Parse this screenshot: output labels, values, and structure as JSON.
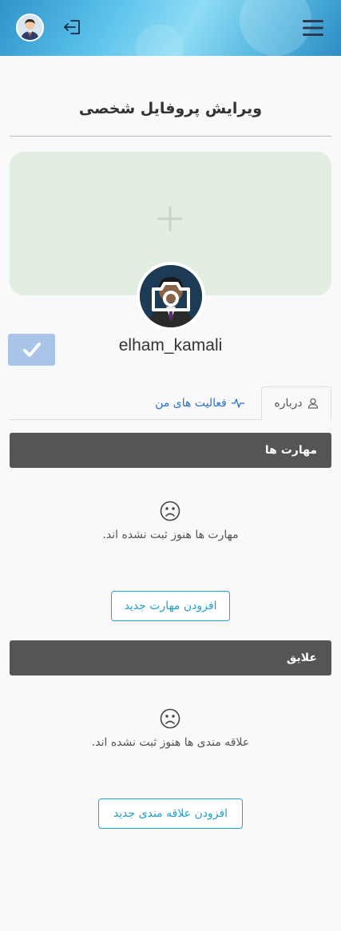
{
  "header": {
    "avatar_icon": "user-avatar-icon",
    "logout_icon": "logout-icon",
    "menu_icon": "hamburger-menu-icon"
  },
  "page": {
    "title": "ویرایش پروفایل شخصی"
  },
  "profile": {
    "cover_icon": "plus-icon",
    "camera_icon": "camera-icon",
    "username": "elham_kamali",
    "confirm_icon": "checkmark-icon",
    "colors": {
      "cover": "#e1eee1",
      "confirm": "#a9c4e6"
    }
  },
  "tabs": [
    {
      "label": "درباره",
      "icon": "user-icon",
      "active": true
    },
    {
      "label": "فعالیت های من",
      "icon": "activity-icon",
      "active": false
    }
  ],
  "skills": {
    "header": "مهارت ها",
    "empty_icon": "sad-face-icon",
    "empty_text": "مهارت ها هنوز ثبت نشده اند.",
    "add_label": "افزودن مهارت جدید"
  },
  "interests": {
    "header": "علایق",
    "empty_icon": "sad-face-icon",
    "empty_text": "علاقه مندی ها هنوز ثبت نشده اند.",
    "add_label": "افزودن علاقه مندی جدید"
  },
  "colors": {
    "section_bar": "#555555",
    "accent": "#1ea7d6",
    "tab_link": "#2b6fd1"
  }
}
